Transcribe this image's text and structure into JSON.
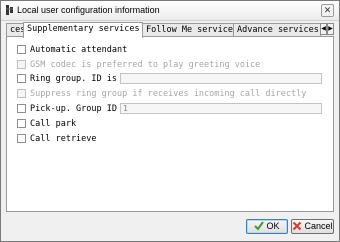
{
  "window": {
    "title": "Local user configuration information",
    "close_label": "✕"
  },
  "tabs": [
    {
      "label": "ces",
      "active": false
    },
    {
      "label": "Supplementary services",
      "active": true
    },
    {
      "label": "Follow Me service",
      "active": false
    },
    {
      "label": "Advance services",
      "active": false
    }
  ],
  "tab_scroll": {
    "left": "◀",
    "right": "▶"
  },
  "options": [
    {
      "label": "Automatic attendant",
      "checked": false,
      "enabled": true
    },
    {
      "label": "GSM codec is preferred to play greeting voice",
      "checked": false,
      "enabled": false
    },
    {
      "label": "Ring group. ID is",
      "checked": false,
      "enabled": true,
      "field_value": ""
    },
    {
      "label": "Suppress ring group if receives incoming call directly",
      "checked": false,
      "enabled": false
    },
    {
      "label": "Pick-up. Group ID is",
      "checked": false,
      "enabled": true,
      "field_value": "1"
    },
    {
      "label": "Call park",
      "checked": false,
      "enabled": true
    },
    {
      "label": "Call retrieve",
      "checked": false,
      "enabled": true
    }
  ],
  "buttons": {
    "ok": "OK",
    "cancel": "Cancel"
  },
  "colors": {
    "ok_check": "#3a9b2c",
    "cancel_x": "#d23b2e"
  }
}
